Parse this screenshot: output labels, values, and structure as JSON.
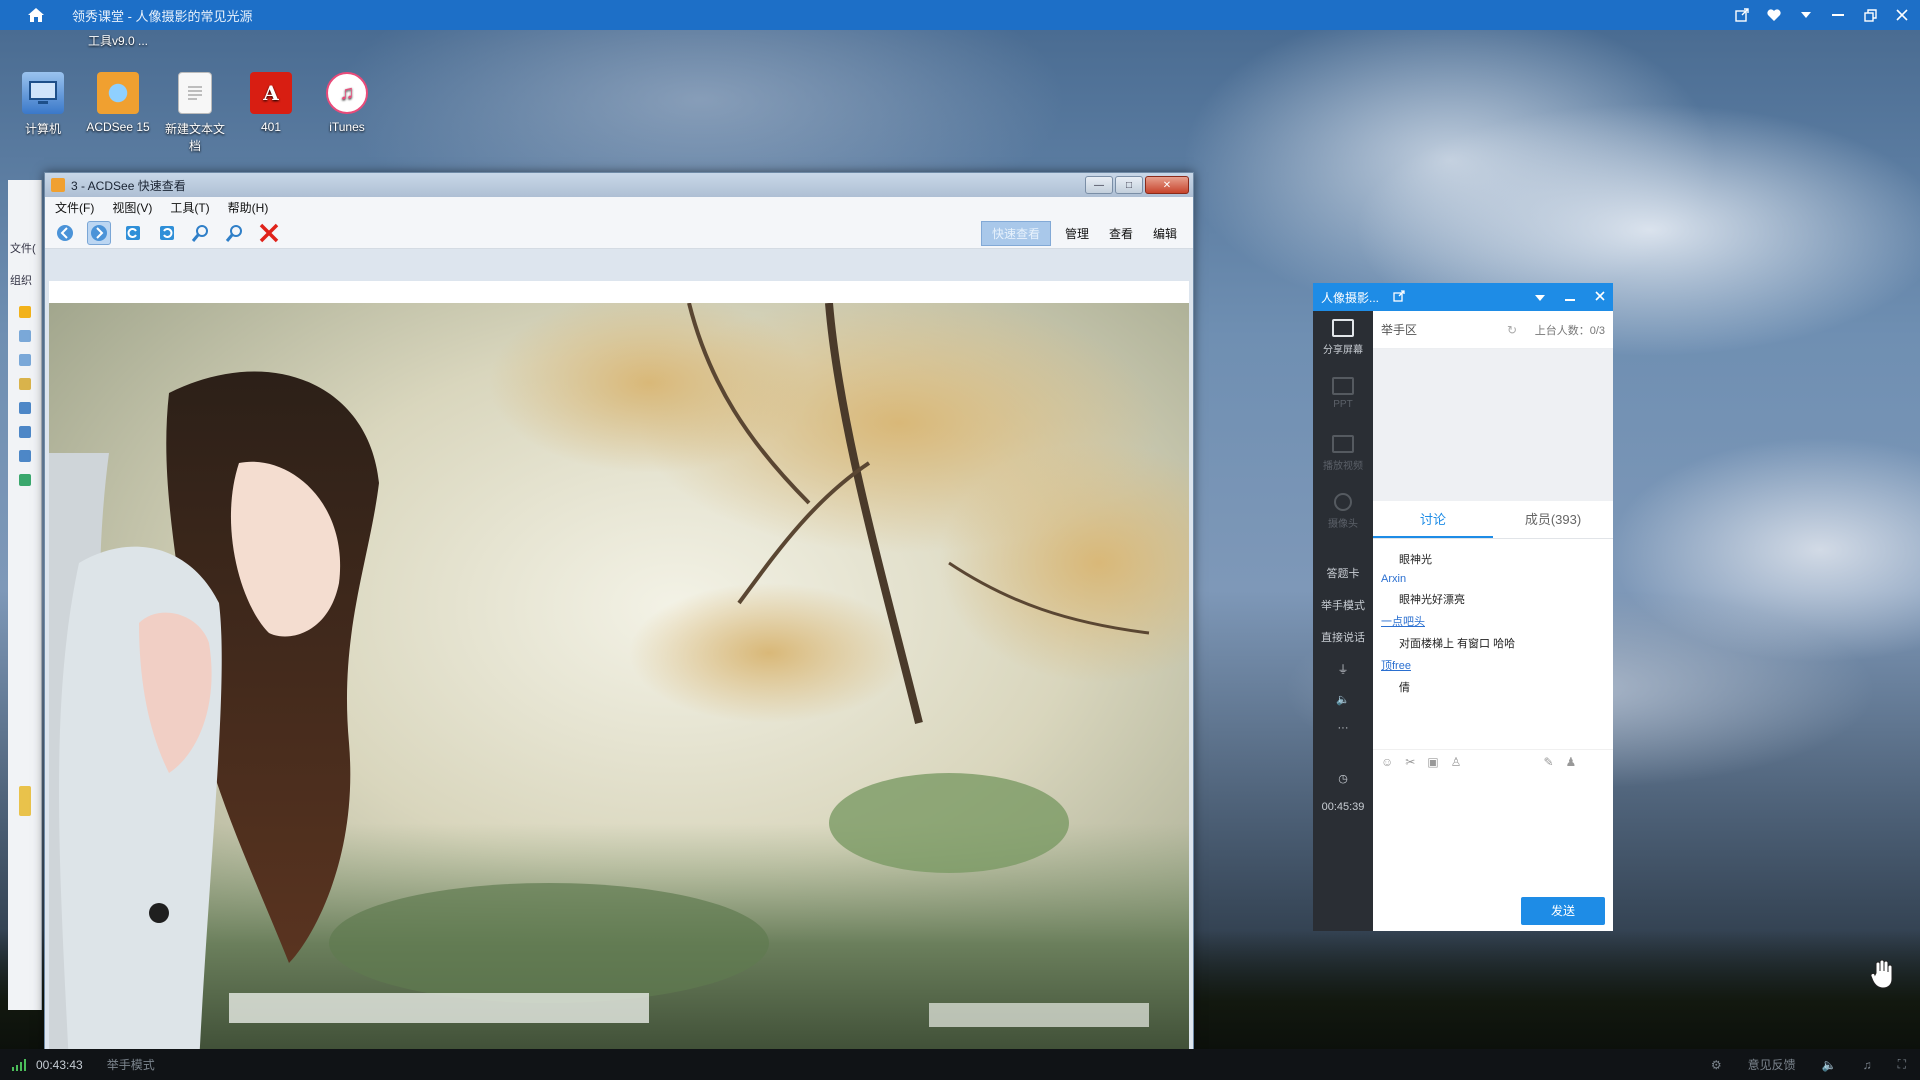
{
  "player": {
    "title": "领秀课堂 - 人像摄影的常见光源",
    "elapsed": "00:43:43",
    "mode": "举手模式",
    "feedback": "意见反馈"
  },
  "desktop": {
    "top_label": "工具v9.0 ...",
    "icons": [
      {
        "label": "计算机",
        "icon": "computer-icon",
        "color": "#3a78c9"
      },
      {
        "label": "ACDSee 15",
        "icon": "acdsee-icon",
        "color": "#f0a030"
      },
      {
        "label": "新建文本文档",
        "icon": "document-icon",
        "color": "#f4f4f4"
      },
      {
        "label": "401",
        "icon": "adobe-pdf-icon",
        "color": "#d81e12"
      },
      {
        "label": "iTunes",
        "icon": "itunes-icon",
        "color": "#ffffff"
      }
    ],
    "side_labels": [
      "文件(",
      "组织"
    ]
  },
  "acdsee": {
    "title": "3 - ACDSee 快速查看",
    "menu": [
      "文件(F)",
      "视图(V)",
      "工具(T)",
      "帮助(H)"
    ],
    "modes": [
      "快速查看",
      "管理",
      "查看",
      "编辑"
    ]
  },
  "classroom": {
    "title": "人像摄影...",
    "hand_zone": "举手区",
    "online_count": "上台人数：0/3",
    "side_items": [
      {
        "label": "分享屏幕",
        "dim": false
      },
      {
        "label": "PPT",
        "dim": true
      },
      {
        "label": "播放视频",
        "dim": true
      },
      {
        "label": "摄像头",
        "dim": true
      }
    ],
    "side_texts": [
      "答题卡",
      "举手模式",
      "直接说话"
    ],
    "timer": "00:45:39",
    "tabs": [
      "讨论",
      "成员(393)"
    ],
    "messages": [
      {
        "name": "",
        "text": "眼神光"
      },
      {
        "name": "Arxin",
        "text": "眼神光好漂亮"
      },
      {
        "name": "一点吧头",
        "text": "对面楼梯上 有窗口 哈哈"
      },
      {
        "name": "顶free",
        "text": "倩"
      }
    ],
    "send_label": "发送"
  }
}
